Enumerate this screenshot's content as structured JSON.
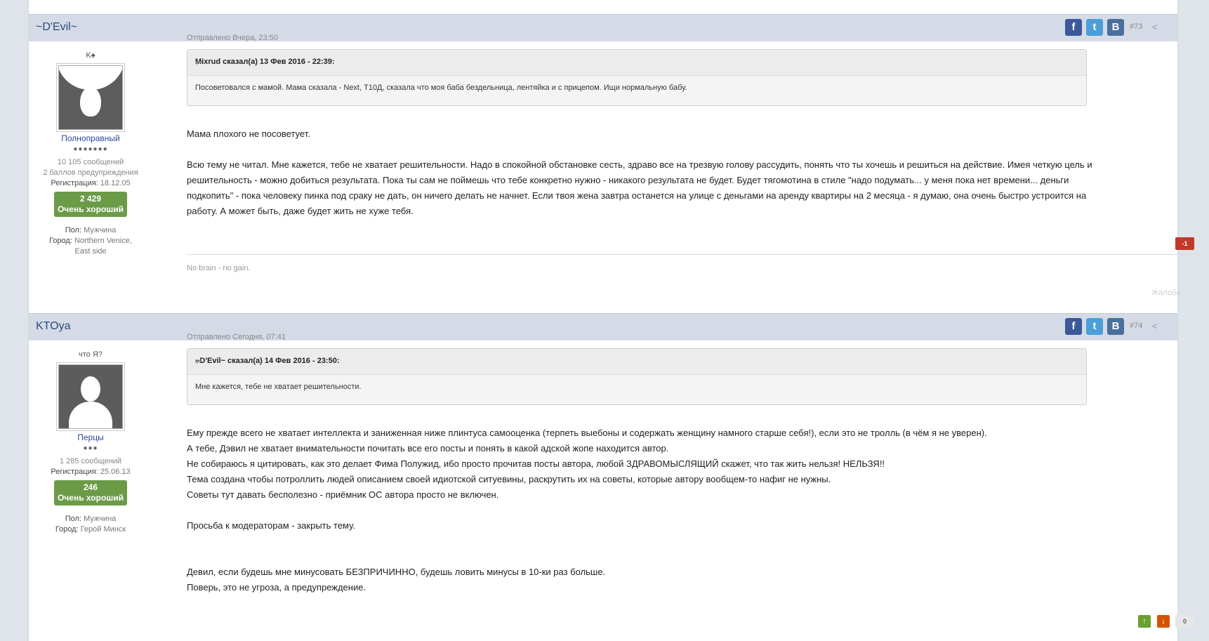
{
  "posts": [
    {
      "username": "~D'Evil~",
      "post_number": "#73",
      "title": "K♠",
      "rank": "Полноправный",
      "rank_dots": "●●●●●●●",
      "messages": "10 105 сообщений",
      "warnings": "2 баллов предупреждения",
      "reg_label": "Регистрация:",
      "reg_date": "18.12.05",
      "rep_value": "2 429",
      "rep_label": "Очень хороший",
      "gender_label": "Пол:",
      "gender": "Мужчина",
      "city_label": "Город:",
      "city": "Northern Venice,",
      "city2": "East side",
      "sent": "Отправлено Вчера, 23:50",
      "quote_header": "Mixrud сказал(а) 13 Фев 2016 - 22:39:",
      "quote_text": "Посоветовался с мамой. Мама сказала - Next, Т10Д, сказала что моя баба бездельница, лентяйка и с прицепом. Ищи нормальную бабу.",
      "text": [
        "Мама плохого не посоветует.",
        "",
        "Всю тему не читал. Мне кажется, тебе не хватает решительности. Надо в спокойной обстановке сесть, здраво все на трезвую голову рассудить, понять что ты хочешь и решиться на действие. Имея четкую цель и",
        "решительность - можно добиться результата. Пока ты сам не поймешь что тебе конкретно нужно - никакого результата не будет. Будет тягомотина в стиле \"надо подумать... у меня пока нет времени... деньги",
        "подкопить\" - пока человеку пинка под сраку не дать, он ничего делать не начнет. Если твоя жена завтра останется на улице с деньгами на аренду квартиры на 2 месяца - я думаю, она очень быстро устроится на",
        "работу. А может быть, даже будет жить не хуже тебя."
      ],
      "vote_score": "-1",
      "signature": "No brain - no gain.",
      "report": "Жалоба"
    },
    {
      "username": "KTOya",
      "post_number": "#74",
      "title": "что Я?",
      "rank": "Перцы",
      "rank_dots": "●●●",
      "messages": "1 285 сообщений",
      "reg_label": "Регистрация:",
      "reg_date": "25.06.13",
      "rep_value": "246",
      "rep_label": "Очень хороший",
      "gender_label": "Пол:",
      "gender": "Мужчина",
      "city_label": "Город:",
      "city": "Герой Минск",
      "sent": "Отправлено Сегодня, 07:41",
      "quote_header": "~D'Evil~ сказал(а) 14 Фев 2016 - 23:50:",
      "quote_text": "Мне кажется, тебе не хватает решительности.",
      "text": [
        "Ему прежде всего не хватает интеллекта и заниженная ниже плинтуса самооценка (терпеть выебоны и содержать женщину намного старше себя!), если это не тролль (в чём я не уверен).",
        "А тебе, Дэвил не хватает внимательности почитать все его посты и понять в какой адской жопе находится автор.",
        "Не собираюсь я цитировать, как это делает Фима Полужид, ибо просто прочитав посты автора, любой ЗДРАВОМЫСЛЯЩИЙ скажет, что так жить нельзя! НЕЛЬЗЯ!!",
        "Тема создана чтобы потроллить людей описанием своей идиотской ситуевины, раскрутить их на советы, которые автору вообщем-то нафиг не нужны.",
        "Советы тут давать бесполезно - приёмник ОС автора просто не включен.",
        "",
        "Просьба к модераторам - закрыть тему.",
        "",
        "",
        "Девил, если будешь мне минусовать БЕЗПРИЧИННО, будешь ловить минусы в 10-ки раз больше.",
        "Поверь, это не угроза, а предупреждение."
      ],
      "vote_score": "0"
    }
  ],
  "icons": {
    "facebook": "f",
    "twitter": "t",
    "vk": "B",
    "share": "<",
    "quote_jump": "↩",
    "up": "↑",
    "down": "↓"
  },
  "colors": {
    "header_bg": "#d5dbe6",
    "username": "#2b4a7c",
    "rep_bg": "#6b9b47",
    "vote_neg": "#c0392b",
    "vote_up": "#6aa12f",
    "vote_down": "#d35400"
  }
}
